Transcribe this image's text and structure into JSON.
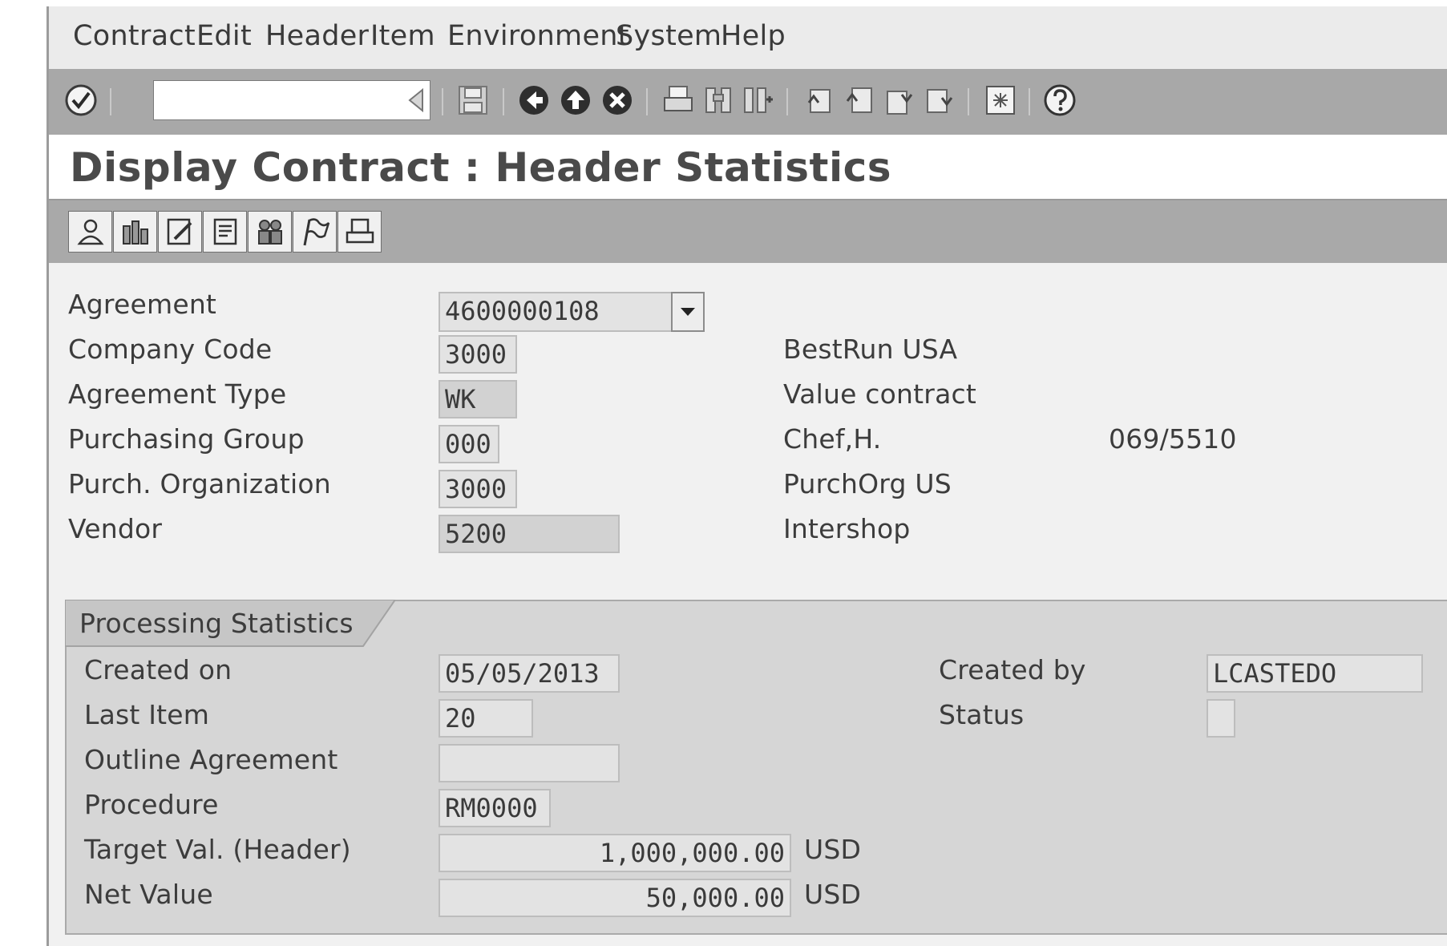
{
  "menu": [
    "Contract",
    "Edit",
    "Header",
    "Item",
    "Environment",
    "System",
    "Help"
  ],
  "toolbar": {
    "command_field_value": "",
    "icons": [
      "enter-icon",
      "back-arrow-icon",
      "save-icon",
      "back-icon",
      "exit-icon",
      "cancel-icon",
      "print-icon",
      "find-icon",
      "find-next-icon",
      "first-page-icon",
      "previous-page-icon",
      "next-page-icon",
      "last-page-icon",
      "layout-icon",
      "help-icon"
    ]
  },
  "page_title": "Display Contract : Header Statistics",
  "app_toolbar": {
    "icons": [
      "partner-icon",
      "conditions-icon",
      "edit-texts-icon",
      "document-icon",
      "people-icon",
      "flag-icon",
      "print-icon"
    ]
  },
  "header_fields": [
    {
      "label": "Agreement",
      "value": "4600000108",
      "description": "",
      "extra": ""
    },
    {
      "label": "Company Code",
      "value": "3000",
      "description": "BestRun USA",
      "extra": ""
    },
    {
      "label": "Agreement Type",
      "value": "WK",
      "description": "Value contract",
      "extra": ""
    },
    {
      "label": "Purchasing Group",
      "value": "000",
      "description": "Chef,H.",
      "extra": "069/5510"
    },
    {
      "label": "Purch. Organization",
      "value": "3000",
      "description": "PurchOrg US",
      "extra": ""
    },
    {
      "label": "Vendor",
      "value": "5200",
      "description": "Intershop",
      "extra": ""
    }
  ],
  "processing_statistics": {
    "title": "Processing Statistics",
    "created_on": {
      "label": "Created on",
      "value": "05/05/2013"
    },
    "last_item": {
      "label": "Last Item",
      "value": "20"
    },
    "outline_agreement": {
      "label": "Outline Agreement",
      "value": ""
    },
    "procedure": {
      "label": "Procedure",
      "value": "RM0000"
    },
    "target_value": {
      "label": "Target Val. (Header)",
      "value": "1,000,000.00",
      "currency": "USD"
    },
    "net_value": {
      "label": "Net Value",
      "value": "50,000.00",
      "currency": "USD"
    },
    "created_by": {
      "label": "Created by",
      "value": "LCASTEDO"
    },
    "status": {
      "label": "Status",
      "value": ""
    }
  }
}
